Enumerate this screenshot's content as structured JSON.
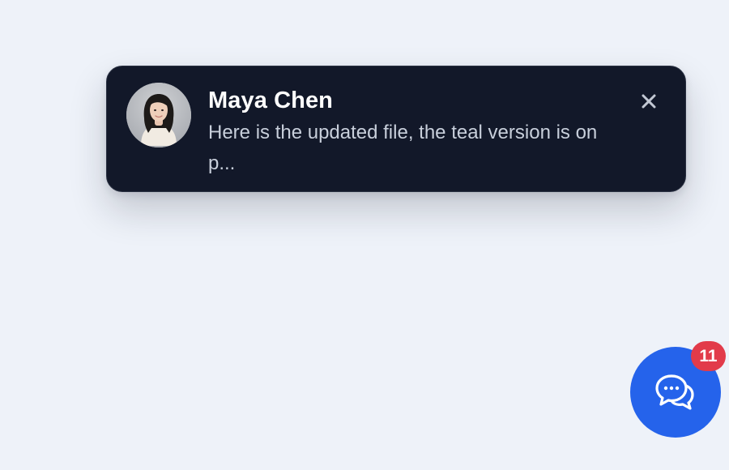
{
  "notification": {
    "sender": "Maya Chen",
    "message": "Here is the updated file, the teal version is on p...",
    "avatar_icon": "avatar-photo",
    "close_icon": "close-icon"
  },
  "chat_launcher": {
    "icon": "chat-bubbles-icon",
    "unread_count": "11"
  },
  "colors": {
    "background": "#eef2f9",
    "toast_background": "#121829",
    "accent": "#2563eb",
    "badge": "#e23b4a"
  }
}
